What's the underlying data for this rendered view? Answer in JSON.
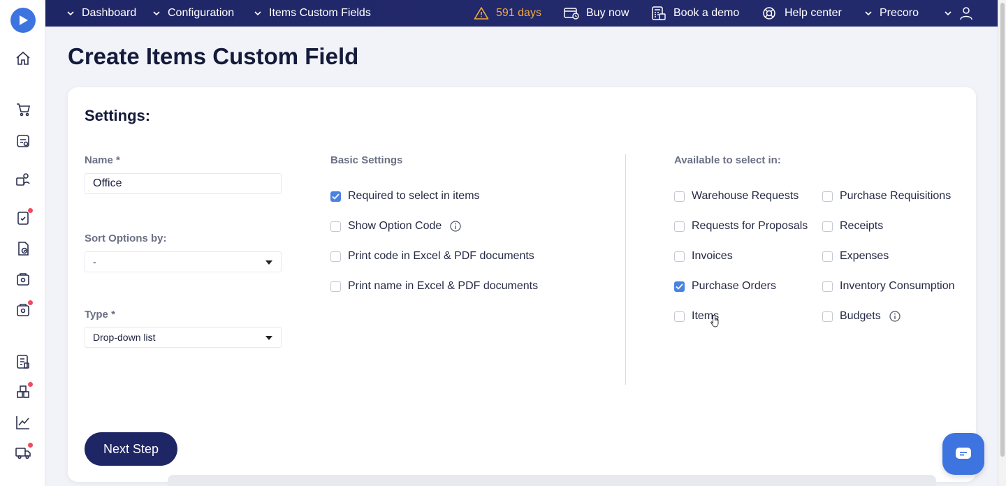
{
  "nav": {
    "breadcrumbs": [
      "Dashboard",
      "Configuration",
      "Items Custom Fields"
    ],
    "trial_days": "591 days",
    "buy_now": "Buy now",
    "book_demo": "Book a demo",
    "help_center": "Help center",
    "company": "Precoro"
  },
  "page": {
    "title": "Create Items Custom Field",
    "settings_title": "Settings:"
  },
  "form": {
    "name_label": "Name *",
    "name_value": "Office",
    "sort_label": "Sort Options by:",
    "sort_value": "-",
    "type_label": "Type *",
    "type_value": "Drop-down list"
  },
  "basic_settings": {
    "title": "Basic Settings",
    "options": [
      {
        "label": "Required to select in items",
        "checked": true
      },
      {
        "label": "Show Option Code",
        "checked": false
      },
      {
        "label": "Print code in Excel & PDF documents",
        "checked": false
      },
      {
        "label": "Print name in Excel & PDF documents",
        "checked": false
      }
    ]
  },
  "available": {
    "title": "Available to select in:",
    "left": [
      {
        "label": "Warehouse Requests",
        "checked": false
      },
      {
        "label": "Requests for Proposals",
        "checked": false
      },
      {
        "label": "Invoices",
        "checked": false
      },
      {
        "label": "Purchase Orders",
        "checked": true
      },
      {
        "label": "Items",
        "checked": false
      }
    ],
    "right": [
      {
        "label": "Purchase Requisitions",
        "checked": false
      },
      {
        "label": "Receipts",
        "checked": false
      },
      {
        "label": "Expenses",
        "checked": false
      },
      {
        "label": "Inventory Consumption",
        "checked": false
      },
      {
        "label": "Budgets",
        "checked": false
      }
    ]
  },
  "actions": {
    "next_step": "Next Step"
  },
  "colors": {
    "navy": "#1f2666",
    "accent_blue": "#3d74e0",
    "warning": "#f5a93b",
    "notification_dot": "#f04a5e"
  }
}
